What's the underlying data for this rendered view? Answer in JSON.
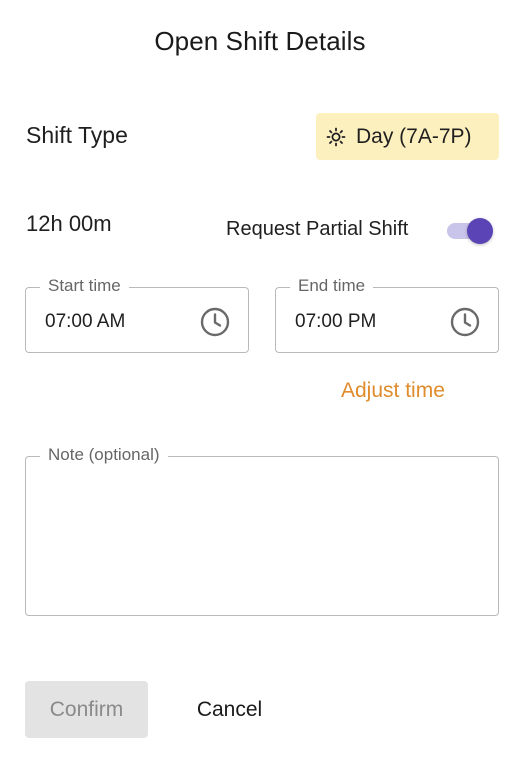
{
  "dialog": {
    "title": "Open Shift Details"
  },
  "shift_type": {
    "label": "Shift Type",
    "value": "Day (7A-7P)",
    "icon": "sun-icon",
    "badge_color": "#fdf0bf"
  },
  "duration": "12h 00m",
  "partial_shift": {
    "label": "Request Partial Shift",
    "enabled": true,
    "accent_color": "#5b44b5"
  },
  "start_time": {
    "label": "Start time",
    "value": "07:00 AM",
    "icon": "clock-icon"
  },
  "end_time": {
    "label": "End time",
    "value": "07:00 PM",
    "icon": "clock-icon"
  },
  "adjust_time": {
    "label": "Adjust time",
    "color": "#e08b2c"
  },
  "note": {
    "label": "Note (optional)",
    "value": ""
  },
  "actions": {
    "confirm_label": "Confirm",
    "cancel_label": "Cancel"
  }
}
